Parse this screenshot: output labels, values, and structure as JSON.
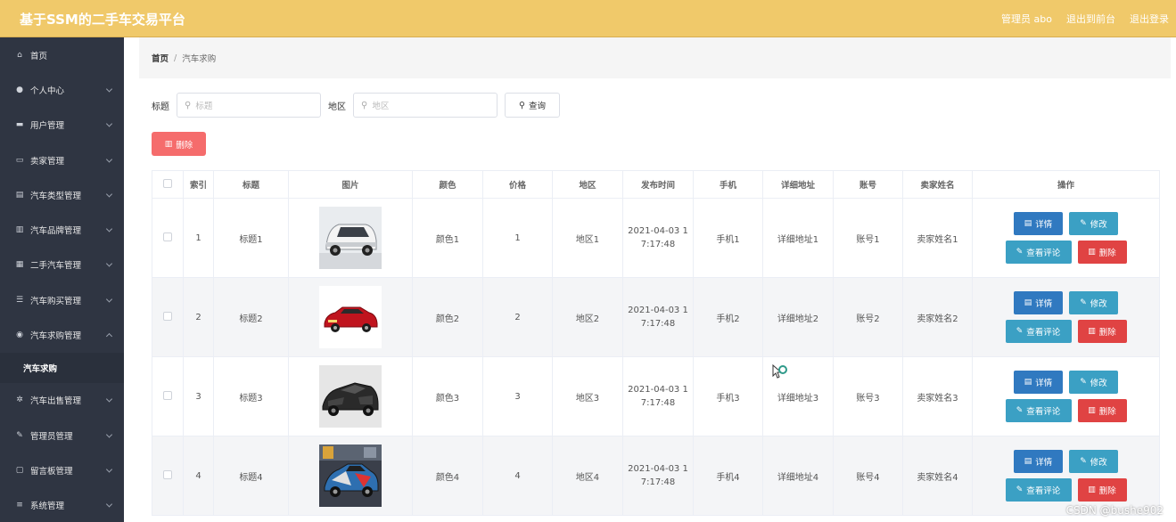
{
  "header": {
    "brand": "基于SSM的二手车交易平台",
    "links": [
      "管理员 abo",
      "退出到前台",
      "退出登录"
    ]
  },
  "sidebar": {
    "items": [
      {
        "label": "首页",
        "icon": "home-icon",
        "glyph": "⌂",
        "chevron": false
      },
      {
        "label": "个人中心",
        "icon": "user-icon",
        "glyph": "●",
        "chevron": true
      },
      {
        "label": "用户管理",
        "icon": "users-icon",
        "glyph": "▬",
        "chevron": true
      },
      {
        "label": "卖家管理",
        "icon": "seller-icon",
        "glyph": "▭",
        "chevron": true
      },
      {
        "label": "汽车类型管理",
        "icon": "car-type-icon",
        "glyph": "▤",
        "chevron": true
      },
      {
        "label": "汽车品牌管理",
        "icon": "brand-icon",
        "glyph": "▥",
        "chevron": true
      },
      {
        "label": "二手汽车管理",
        "icon": "grid-icon",
        "glyph": "▦",
        "chevron": true
      },
      {
        "label": "汽车购买管理",
        "icon": "sliders-icon",
        "glyph": "☰",
        "chevron": true
      },
      {
        "label": "汽车求购管理",
        "icon": "location-icon",
        "glyph": "◉",
        "chevron": "up"
      }
    ],
    "sub_item": "汽车求购",
    "items_after": [
      {
        "label": "汽车出售管理",
        "icon": "settings-icon",
        "glyph": "✲",
        "chevron": true
      },
      {
        "label": "管理员管理",
        "icon": "admin-icon",
        "glyph": "✎",
        "chevron": true
      },
      {
        "label": "留言板管理",
        "icon": "message-icon",
        "glyph": "▢",
        "chevron": true
      },
      {
        "label": "系统管理",
        "icon": "menu-icon",
        "glyph": "≡",
        "chevron": true
      }
    ]
  },
  "breadcrumb": {
    "home": "首页",
    "separator": "/",
    "current": "汽车求购"
  },
  "search": {
    "title_label": "标题",
    "title_placeholder": "标题",
    "region_label": "地区",
    "region_placeholder": "地区",
    "query_button": "查询"
  },
  "delete_button": "删除",
  "table": {
    "headers": [
      "索引",
      "标题",
      "图片",
      "颜色",
      "价格",
      "地区",
      "发布时间",
      "手机",
      "详细地址",
      "账号",
      "卖家姓名",
      "操作"
    ],
    "rows": [
      {
        "index": "1",
        "title": "标题1",
        "image": "white-minivan",
        "color": "颜色1",
        "price": "1",
        "region": "地区1",
        "time_line1": "2021-04-03 1",
        "time_line2": "7:17:48",
        "phone": "手机1",
        "address": "详细地址1",
        "account": "账号1",
        "seller": "卖家姓名1"
      },
      {
        "index": "2",
        "title": "标题2",
        "image": "red-sedan",
        "color": "颜色2",
        "price": "2",
        "region": "地区2",
        "time_line1": "2021-04-03 1",
        "time_line2": "7:17:48",
        "phone": "手机2",
        "address": "详细地址2",
        "account": "账号2",
        "seller": "卖家姓名2"
      },
      {
        "index": "3",
        "title": "标题3",
        "image": "black-supercar",
        "color": "颜色3",
        "price": "3",
        "region": "地区3",
        "time_line1": "2021-04-03 1",
        "time_line2": "7:17:48",
        "phone": "手机3",
        "address": "详细地址3",
        "account": "账号3",
        "seller": "卖家姓名3"
      },
      {
        "index": "4",
        "title": "标题4",
        "image": "wrapped-sportscar",
        "color": "颜色4",
        "price": "4",
        "region": "地区4",
        "time_line1": "2021-04-03 1",
        "time_line2": "7:17:48",
        "phone": "手机4",
        "address": "详细地址4",
        "account": "账号4",
        "seller": "卖家姓名4"
      }
    ],
    "actions": {
      "detail": "详情",
      "edit": "修改",
      "comments": "查看评论",
      "delete": "删除"
    }
  },
  "watermark": "CSDN @bushe902",
  "colors": {
    "header": "#f0c96a",
    "sidebar": "#2f3542",
    "danger": "#f56c6c",
    "primary": "#3079c0",
    "info": "#3ba0c4"
  }
}
